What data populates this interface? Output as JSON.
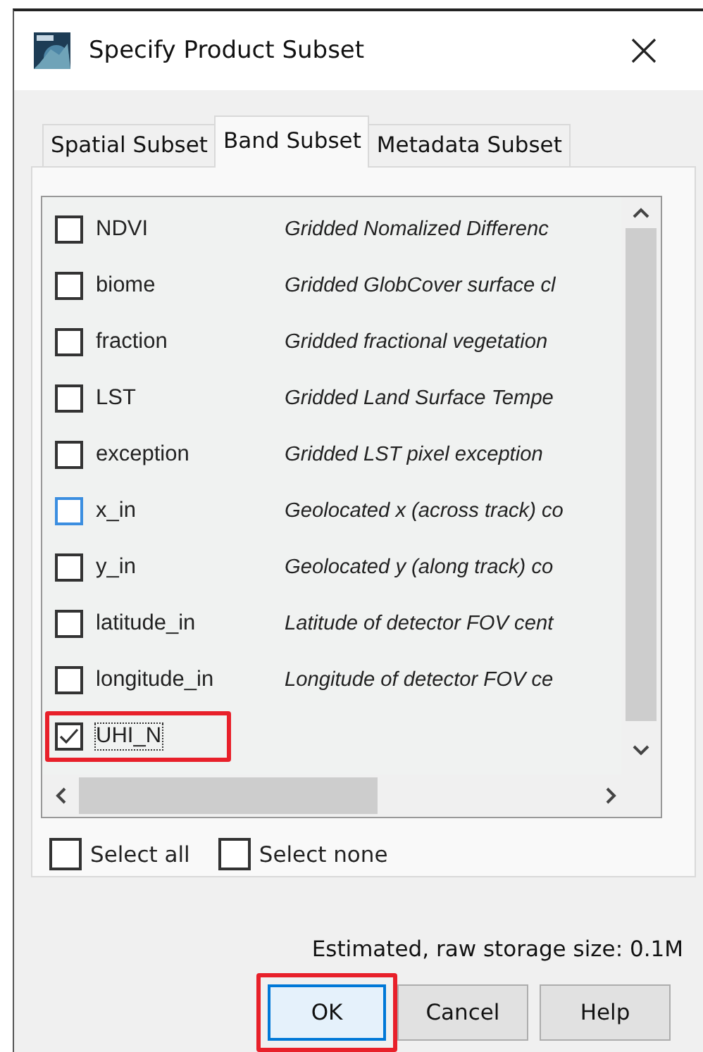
{
  "window": {
    "title": "Specify Product Subset"
  },
  "tabs": [
    {
      "label": "Spatial Subset",
      "selected": false
    },
    {
      "label": "Band Subset",
      "selected": true
    },
    {
      "label": "Metadata Subset",
      "selected": false
    }
  ],
  "bands": [
    {
      "name": "NDVI",
      "description": "Gridded Nomalized Differenc",
      "checked": false,
      "hovered": false,
      "focused": false,
      "highlighted": false
    },
    {
      "name": "biome",
      "description": "Gridded GlobCover surface cl",
      "checked": false,
      "hovered": false,
      "focused": false,
      "highlighted": false
    },
    {
      "name": "fraction",
      "description": "Gridded fractional vegetation",
      "checked": false,
      "hovered": false,
      "focused": false,
      "highlighted": false
    },
    {
      "name": "LST",
      "description": "Gridded Land Surface Tempe",
      "checked": false,
      "hovered": false,
      "focused": false,
      "highlighted": false
    },
    {
      "name": "exception",
      "description": "Gridded LST pixel exception",
      "checked": false,
      "hovered": false,
      "focused": false,
      "highlighted": false
    },
    {
      "name": "x_in",
      "description": "Geolocated x (across track) co",
      "checked": false,
      "hovered": true,
      "focused": false,
      "highlighted": false
    },
    {
      "name": "y_in",
      "description": "Geolocated y (along track) co",
      "checked": false,
      "hovered": false,
      "focused": false,
      "highlighted": false
    },
    {
      "name": "latitude_in",
      "description": "Latitude of detector FOV cent",
      "checked": false,
      "hovered": false,
      "focused": false,
      "highlighted": false
    },
    {
      "name": "longitude_in",
      "description": "Longitude of detector FOV ce",
      "checked": false,
      "hovered": false,
      "focused": false,
      "highlighted": false
    },
    {
      "name": "UHI_N",
      "checked": true,
      "hovered": false,
      "focused": true,
      "highlighted": true
    }
  ],
  "select_options": [
    {
      "label": "Select all",
      "checked": false
    },
    {
      "label": "Select none",
      "checked": false
    }
  ],
  "storage_estimate": "Estimated, raw storage size: 0.1M",
  "buttons": [
    {
      "label": "OK",
      "default": true,
      "highlighted": true
    },
    {
      "label": "Cancel",
      "default": false,
      "highlighted": false
    },
    {
      "label": "Help",
      "default": false,
      "highlighted": false
    }
  ]
}
